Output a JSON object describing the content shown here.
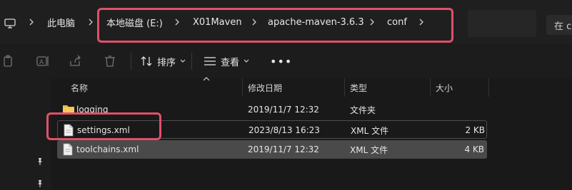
{
  "address": {
    "crumbs": [
      "此电脑",
      "本地磁盘 (E:)",
      "X01Maven",
      "apache-maven-3.6.3",
      "conf"
    ],
    "search_placeholder": "在 c"
  },
  "commands": {
    "sort_label": "排序",
    "view_label": "查看",
    "more_label": "•••"
  },
  "list": {
    "columns": {
      "name": "名称",
      "modified": "修改日期",
      "type": "类型",
      "size": "大小"
    },
    "rows": [
      {
        "name": "logging",
        "modified": "2019/11/7 12:32",
        "type": "文件夹",
        "size": "",
        "kind": "folder"
      },
      {
        "name": "settings.xml",
        "modified": "2023/8/13 16:23",
        "type": "XML 文件",
        "size": "2 KB",
        "kind": "file"
      },
      {
        "name": "toolchains.xml",
        "modified": "2019/11/7 12:32",
        "type": "XML 文件",
        "size": "4 KB",
        "kind": "file"
      }
    ]
  },
  "colors": {
    "highlight": "#e0506a",
    "folder": "#e9b949",
    "selected_row": "#4a4a4a"
  }
}
